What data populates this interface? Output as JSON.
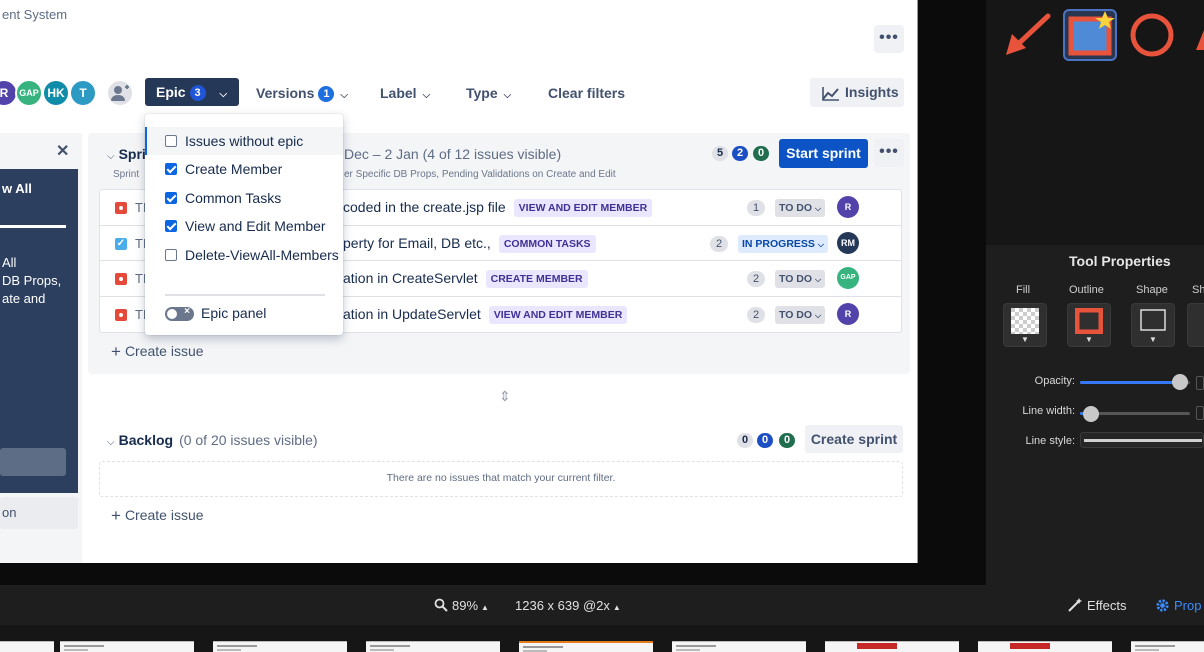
{
  "page": {
    "title_partial": "ent System",
    "header_more": "•••"
  },
  "filters": {
    "avatars": [
      {
        "initials": "R",
        "color": "#5243aa"
      },
      {
        "initials": "GAP",
        "color": "#36b37e"
      },
      {
        "initials": "HK",
        "color": "#0f8ca8"
      },
      {
        "initials": "T",
        "color": "#2d9ac4"
      }
    ],
    "epic": {
      "label": "Epic",
      "count": "3"
    },
    "versions": {
      "label": "Versions",
      "count": "1"
    },
    "label": "Label",
    "type": "Type",
    "clear": "Clear filters",
    "insights": "Insights"
  },
  "epic_dropdown": {
    "items": [
      {
        "label": "Issues without epic",
        "checked": false
      },
      {
        "label": "Create Member",
        "checked": true
      },
      {
        "label": "Common Tasks",
        "checked": true
      },
      {
        "label": "View and Edit Member",
        "checked": true
      },
      {
        "label": "Delete-ViewAll-Members",
        "checked": false
      }
    ],
    "toggle_label": "Epic panel"
  },
  "epic_panel": {
    "heading": "w All",
    "desc_lines": [
      "All",
      "DB Props,",
      "ate and"
    ],
    "footer": "on"
  },
  "sprint": {
    "name": "Spri",
    "dates": "Dec – 2 Jan  (4 of 12 issues visible)",
    "goal_start": "Sprint",
    "goal_end": "er Specific DB Props, Pending Validations on Create and Edit",
    "counts": [
      "5",
      "2",
      "0"
    ],
    "start_button": "Start sprint",
    "issues": [
      {
        "key": "TM",
        "summary": "coded in the create.jsp file",
        "epic": "VIEW AND EDIT MEMBER",
        "points": "1",
        "status": "TO DO",
        "assignee": "R",
        "assignee_color": "#5243aa"
      },
      {
        "key": "TM",
        "summary": "perty for Email, DB etc.,",
        "epic": "COMMON TASKS",
        "points": "2",
        "status": "IN PROGRESS",
        "assignee": "RM",
        "assignee_color": "#253858"
      },
      {
        "key": "TM",
        "summary": "ation in CreateServlet",
        "epic": "CREATE MEMBER",
        "points": "2",
        "status": "TO DO",
        "assignee": "GAP",
        "assignee_color": "#36b37e"
      },
      {
        "key": "TM",
        "summary": "ation in UpdateServlet",
        "epic": "VIEW AND EDIT MEMBER",
        "points": "2",
        "status": "TO DO",
        "assignee": "R",
        "assignee_color": "#5243aa"
      }
    ],
    "create_issue": "Create issue"
  },
  "backlog": {
    "title": "Backlog",
    "visible": "(0 of 20 issues visible)",
    "counts": [
      "0",
      "0",
      "0"
    ],
    "create_sprint": "Create sprint",
    "empty_message": "There are no issues that match your current filter.",
    "create_issue": "Create issue"
  },
  "tool_properties": {
    "title": "Tool Properties",
    "columns": [
      "Fill",
      "Outline",
      "Shape",
      "Sh"
    ],
    "opacity_label": "Opacity:",
    "opacity_level": 0.91,
    "line_width_label": "Line width:",
    "line_width_level": 0.1,
    "line_style_label": "Line style:",
    "accent_color": "#3478f6"
  },
  "bottom_bar": {
    "zoom": "89%",
    "dimensions": "1236 x 639 @2x",
    "effects": "Effects",
    "properties": "Prop"
  }
}
